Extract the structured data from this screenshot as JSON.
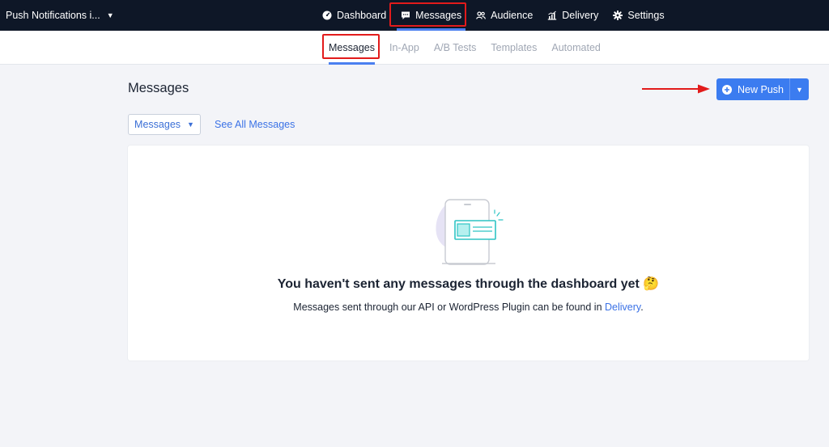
{
  "app": {
    "name": "Push Notifications i..."
  },
  "topnav": [
    {
      "label": "Dashboard",
      "icon": "dashboard-gauge-icon"
    },
    {
      "label": "Messages",
      "icon": "message-bubble-icon",
      "active": true
    },
    {
      "label": "Audience",
      "icon": "users-icon"
    },
    {
      "label": "Delivery",
      "icon": "bar-chart-icon"
    },
    {
      "label": "Settings",
      "icon": "gear-icon"
    }
  ],
  "subnav": [
    {
      "label": "Messages",
      "active": true
    },
    {
      "label": "In-App"
    },
    {
      "label": "A/B Tests"
    },
    {
      "label": "Templates"
    },
    {
      "label": "Automated"
    }
  ],
  "main": {
    "title": "Messages",
    "new_push_label": "New Push",
    "filter_value": "Messages",
    "see_all_label": "See All Messages"
  },
  "empty_state": {
    "title": "You haven't sent any messages through the dashboard yet",
    "emoji": "🤔",
    "subtitle_before": "Messages sent through our API or WordPress Plugin can be found in ",
    "subtitle_link": "Delivery",
    "subtitle_after": "."
  },
  "colors": {
    "topbar": "#0e1727",
    "accent": "#3b7cf0",
    "annotation_red": "#e21b1b",
    "illustration_teal": "#2ec4c4"
  }
}
